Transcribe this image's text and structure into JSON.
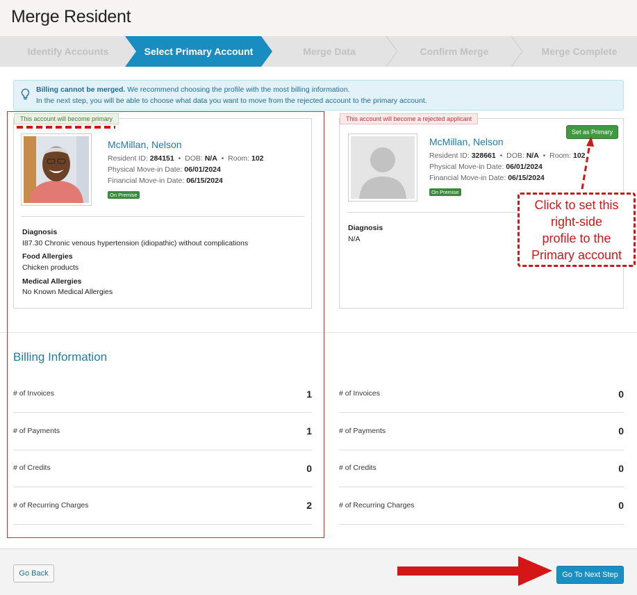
{
  "page": {
    "title": "Merge Resident"
  },
  "steps": [
    {
      "label": "Identify Accounts"
    },
    {
      "label": "Select Primary Account"
    },
    {
      "label": "Merge Data"
    },
    {
      "label": "Confirm Merge"
    },
    {
      "label": "Merge Complete"
    }
  ],
  "info": {
    "bold": "Billing cannot be merged.",
    "line1_rest": " We recommend choosing the profile with the most billing information.",
    "line2": "In the next step, you will be able to choose what data you want to move from the rejected account to the primary account."
  },
  "left_profile": {
    "tag": "This account will become primary",
    "name": "McMillan, Nelson",
    "resident_id_label": "Resident ID: ",
    "resident_id": "284151",
    "dob_label": "DOB: ",
    "dob": "N/A",
    "room_label": "Room: ",
    "room": "102",
    "physical_label": "Physical Move-in Date: ",
    "physical": "06/01/2024",
    "financial_label": "Financial Move-in Date: ",
    "financial": "06/15/2024",
    "badge": "On Premise",
    "diagnosis_title": "Diagnosis",
    "diagnosis": "I87.30 Chronic venous hypertension (idiopathic) without complications",
    "food_title": "Food Allergies",
    "food": "Chicken products",
    "medical_title": "Medical Allergies",
    "medical": "No Known Medical Allergies"
  },
  "right_profile": {
    "tag": "This account will become a rejected applicant",
    "set_primary": "Set as Primary",
    "name": "McMillan, Nelson",
    "resident_id_label": "Resident ID: ",
    "resident_id": "328661",
    "dob_label": "DOB: ",
    "dob": "N/A",
    "room_label": "Room: ",
    "room": "102",
    "physical_label": "Physical Move-in Date: ",
    "physical": "06/01/2024",
    "financial_label": "Financial Move-in Date: ",
    "financial": "06/15/2024",
    "badge": "On Premise",
    "diagnosis_title": "Diagnosis",
    "diagnosis": "N/A"
  },
  "billing": {
    "title": "Billing Information",
    "left": [
      {
        "label": "# of Invoices",
        "value": "1"
      },
      {
        "label": "# of Payments",
        "value": "1"
      },
      {
        "label": "# of Credits",
        "value": "0"
      },
      {
        "label": "# of Recurring Charges",
        "value": "2"
      }
    ],
    "right": [
      {
        "label": "# of Invoices",
        "value": "0"
      },
      {
        "label": "# of Payments",
        "value": "0"
      },
      {
        "label": "# of Credits",
        "value": "0"
      },
      {
        "label": "# of Recurring Charges",
        "value": "0"
      }
    ]
  },
  "callout": {
    "line1": "Click to set this",
    "line2": "right-side",
    "line3": "profile to the",
    "line4": "Primary account"
  },
  "footer": {
    "back": "Go Back",
    "next": "Go To Next Step"
  },
  "colors": {
    "accent": "#1a8dc0",
    "success": "#3f9a3f",
    "annotation": "#d01717"
  }
}
